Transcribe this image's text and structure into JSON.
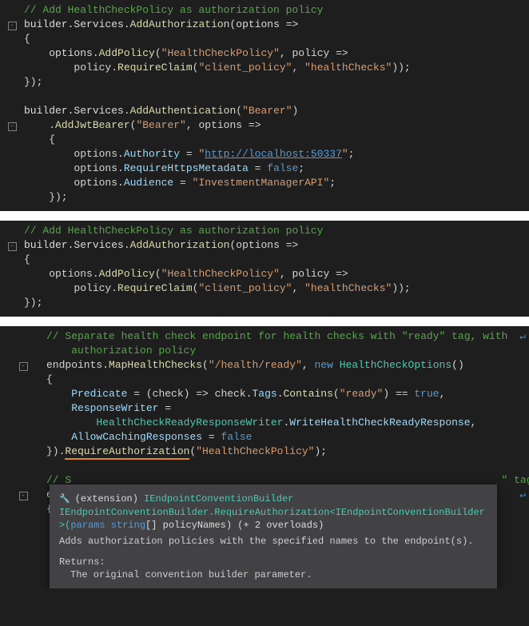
{
  "pane1": {
    "c1": "// Add HealthCheckPolicy as authorization policy",
    "l2a": "builder",
    "l2b": ".",
    "l2c": "Services",
    "l2d": ".",
    "l2e": "AddAuthorization",
    "l2f": "(options =>",
    "l3": "{",
    "l4a": "    options.",
    "l4b": "AddPolicy",
    "l4c": "(",
    "l4d": "\"HealthCheckPolicy\"",
    "l4e": ", policy =>",
    "l5a": "        policy.",
    "l5b": "RequireClaim",
    "l5c": "(",
    "l5d": "\"client_policy\"",
    "l5e": ", ",
    "l5f": "\"healthChecks\"",
    "l5g": "));",
    "l6": "});",
    "l8a": "builder.",
    "l8b": "Services",
    "l8c": ".",
    "l8d": "AddAuthentication",
    "l8e": "(",
    "l8f": "\"Bearer\"",
    "l8g": ")",
    "l9a": "    .",
    "l9b": "AddJwtBearer",
    "l9c": "(",
    "l9d": "\"Bearer\"",
    "l9e": ", options =>",
    "l10": "    {",
    "l11a": "        options.",
    "l11b": "Authority",
    "l11c": " = ",
    "l11d": "\"",
    "l11e": "http://localhost:50337",
    "l11f": "\"",
    "l11g": ";",
    "l12a": "        options.",
    "l12b": "RequireHttpsMetadata",
    "l12c": " = ",
    "l12d": "false",
    "l12e": ";",
    "l13a": "        options.",
    "l13b": "Audience",
    "l13c": " = ",
    "l13d": "\"InvestmentManagerAPI\"",
    "l13e": ";",
    "l14": "    });"
  },
  "pane2": {
    "c1": "// Add HealthCheckPolicy as authorization policy",
    "l2a": "builder",
    "l2b": ".",
    "l2c": "Services",
    "l2d": ".",
    "l2e": "AddAuthorization",
    "l2f": "(options =>",
    "l3": "{",
    "l4a": "    options.",
    "l4b": "AddPolicy",
    "l4c": "(",
    "l4d": "\"HealthCheckPolicy\"",
    "l4e": ", policy =>",
    "l5a": "        policy.",
    "l5b": "RequireClaim",
    "l5c": "(",
    "l5d": "\"client_policy\"",
    "l5e": ", ",
    "l5f": "\"healthChecks\"",
    "l5g": "));",
    "l6": "});"
  },
  "pane3": {
    "c1a": "// Separate health check endpoint for health checks with ",
    "c1b": "\"ready\"",
    "c1c": " tag, with ",
    "c2": "authorization policy",
    "l3a": "endpoints.",
    "l3b": "MapHealthChecks",
    "l3c": "(",
    "l3d": "\"/health/ready\"",
    "l3e": ", ",
    "l3f": "new",
    "l3g": " ",
    "l3h": "HealthCheckOptions",
    "l3i": "()",
    "l4": "{",
    "l5a": "    ",
    "l5b": "Predicate",
    "l5c": " = (check) => check.",
    "l5d": "Tags",
    "l5e": ".",
    "l5f": "Contains",
    "l5g": "(",
    "l5h": "\"ready\"",
    "l5i": ") == ",
    "l5j": "true",
    "l5k": ",",
    "l6a": "    ",
    "l6b": "ResponseWriter",
    "l6c": " =",
    "l7a": "        ",
    "l7b": "HealthCheckReadyResponseWriter",
    "l7c": ".",
    "l7d": "WriteHealthCheckReadyResponse",
    "l7e": ",",
    "l8a": "    ",
    "l8b": "AllowCachingResponses",
    "l8c": " = ",
    "l8d": "false",
    "l9a": "}).",
    "l9b": "RequireAuthorization",
    "l9c": "(",
    "l9d": "\"HealthCheckPolicy\"",
    "l9e": ");",
    "c10a": "// S",
    "c10b": "\"",
    "c10c": " tag",
    "l11": "endp",
    "l12": "{"
  },
  "tooltip": {
    "ext": "(extension)",
    "return_t": " IEndpointConventionBuilder",
    "sig1": "IEndpointConventionBuilder.RequireAuthorization<IEndpointConventionBuilder>(",
    "sig_params": "params",
    "sig2": "string",
    "sig3": "[] policyNames)",
    "overloads": " (+ 2 overloads)",
    "desc": "Adds authorization policies with the specified names to the endpoint(s).",
    "returns_h": "Returns:",
    "returns": "The original convention builder parameter."
  },
  "glyphs": {
    "fold": "-",
    "wrap": "↵",
    "ticon": "🔧"
  }
}
